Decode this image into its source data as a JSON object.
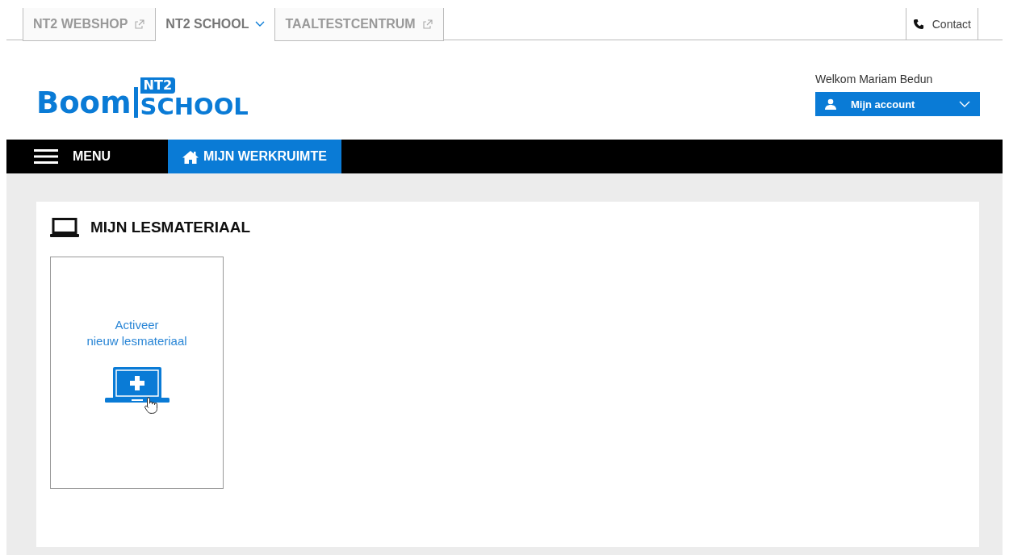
{
  "top_nav": {
    "tabs": [
      {
        "label": "NT2 WEBSHOP",
        "kind": "external",
        "selected": false
      },
      {
        "label": "NT2 SCHOOL",
        "kind": "dropdown",
        "selected": true
      },
      {
        "label": "TAALTESTCENTRUM",
        "kind": "external",
        "selected": false
      }
    ],
    "contact": "Contact"
  },
  "logo": {
    "word": "Boom",
    "badge": "NT2",
    "subword": "SCHOOL"
  },
  "user": {
    "welcome": "Welkom Mariam Bedun",
    "account_button": "Mijn account"
  },
  "main_nav": {
    "menu": "MENU",
    "items": [
      {
        "label": "MIJN WERKRUIMTE",
        "selected": true
      }
    ]
  },
  "section": {
    "title": "MIJN LESMATERIAAL",
    "cards": [
      {
        "kind": "activate",
        "lines": [
          "Activeer",
          "nieuw lesmateriaal"
        ]
      }
    ]
  }
}
